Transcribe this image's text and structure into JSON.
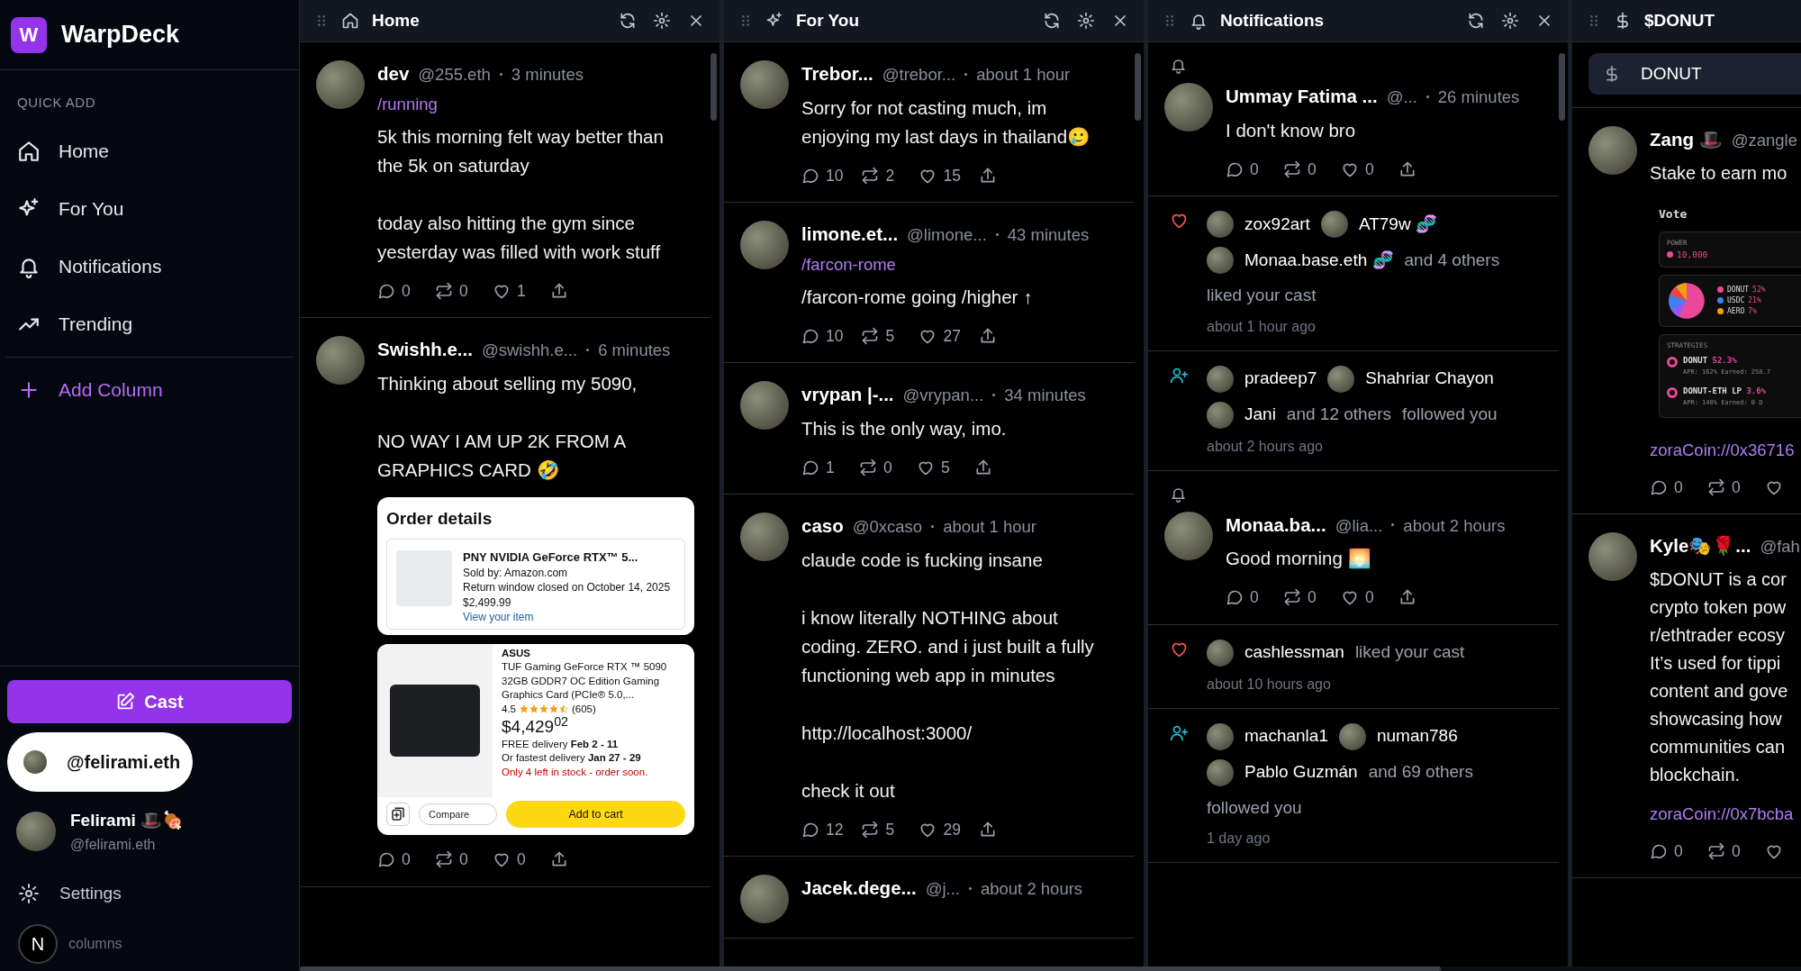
{
  "app": {
    "logo_letter": "W",
    "name": "WarpDeck"
  },
  "sidebar": {
    "section_label": "QUICK ADD",
    "items": [
      {
        "label": "Home"
      },
      {
        "label": "For You"
      },
      {
        "label": "Notifications"
      },
      {
        "label": "Trending"
      }
    ],
    "add_column": "Add Column",
    "cast_button": "Cast",
    "account_chip": "@felirami.eth",
    "profile": {
      "name": "Felirami 🎩🍖",
      "handle": "@felirami.eth"
    },
    "settings": "Settings",
    "dev_badge": "N",
    "footer": "columns"
  },
  "columns": [
    {
      "title": "Home",
      "posts": [
        {
          "author": "dev",
          "handle": "@255.eth",
          "time": "3 minutes",
          "channel": "/running",
          "text": "5k this morning felt way better than the 5k on saturday\n\ntoday also hitting the gym since yesterday was filled with work stuff",
          "actions": [
            {
              "kind": "reply",
              "count": "0"
            },
            {
              "kind": "recast",
              "count": "0"
            },
            {
              "kind": "like",
              "count": "1"
            },
            {
              "kind": "share"
            }
          ]
        },
        {
          "author": "Swishh.e...",
          "handle": "@swishh.e...",
          "time": "6 minutes",
          "text": "Thinking about selling my 5090,\n\nNO WAY I AM UP 2K FROM A GRAPHICS CARD 🤣",
          "media": [
            {
              "kind": "order_details",
              "title": "Order details",
              "item_title": "PNY NVIDIA GeForce RTX™ 5...",
              "seller": "Sold by: Amazon.com",
              "return_note": "Return window closed on October 14, 2025",
              "price": "$2,499.99",
              "link": "View your item"
            },
            {
              "kind": "product_listing",
              "brand": "ASUS",
              "title": "TUF Gaming GeForce RTX ™ 5090 32GB GDDR7 OC Edition Gaming Graphics Card (PCIe® 5.0,...",
              "rating": "4.5",
              "stars": 4.5,
              "reviews": "(605)",
              "price": "$4,429$^{02}$",
              "delivery": "FREE delivery **Feb 2 - 11**",
              "fastest": "Or fastest delivery **Jan 27 - 29**",
              "stock": "Only 4 left in stock - order soon.",
              "compare": "Compare",
              "cart": "Add to cart"
            }
          ],
          "actions": [
            {
              "kind": "reply",
              "count": "0"
            },
            {
              "kind": "recast",
              "count": "0"
            },
            {
              "kind": "like",
              "count": "0"
            },
            {
              "kind": "share"
            }
          ]
        }
      ]
    },
    {
      "title": "For You",
      "posts": [
        {
          "author": "Trebor...",
          "handle": "@trebor...",
          "time": "about 1 hour",
          "text": "Sorry for not casting much, im enjoying my last days in thailand🥲",
          "actions": [
            {
              "kind": "reply",
              "count": "10"
            },
            {
              "kind": "recast",
              "count": "2"
            },
            {
              "kind": "like",
              "count": "15"
            },
            {
              "kind": "share"
            }
          ]
        },
        {
          "author": "limone.et...",
          "handle": "@limone...",
          "time": "43 minutes",
          "channel": "/farcon-rome",
          "text": "/farcon-rome going /higher ↑",
          "actions": [
            {
              "kind": "reply",
              "count": "10"
            },
            {
              "kind": "recast",
              "count": "5"
            },
            {
              "kind": "like",
              "count": "27"
            },
            {
              "kind": "share"
            }
          ]
        },
        {
          "author": "vrypan |-...",
          "handle": "@vrypan...",
          "time": "34 minutes",
          "text": "This is the only way, imo.",
          "actions": [
            {
              "kind": "reply",
              "count": "1"
            },
            {
              "kind": "recast",
              "count": "0"
            },
            {
              "kind": "like",
              "count": "5"
            },
            {
              "kind": "share"
            }
          ]
        },
        {
          "author": "caso",
          "handle": "@0xcaso",
          "time": "about 1 hour",
          "text": "claude code is fucking insane\n\ni know literally NOTHING about coding. ZERO. and i just built a fully functioning web app in minutes\n\nhttp://localhost:3000/\n\ncheck it out",
          "actions": [
            {
              "kind": "reply",
              "count": "12"
            },
            {
              "kind": "recast",
              "count": "5"
            },
            {
              "kind": "like",
              "count": "29"
            },
            {
              "kind": "share"
            }
          ]
        },
        {
          "author": "Jacek.dege...",
          "handle": "@j...",
          "time": "about 2 hours"
        }
      ]
    },
    {
      "title": "Notifications",
      "notifications": [
        {
          "kind": "mention",
          "post": {
            "author": "Ummay Fatima ...",
            "handle": "@...",
            "time": "26 minutes",
            "text": "I don't know bro",
            "actions": [
              {
                "kind": "reply",
                "count": "0"
              },
              {
                "kind": "recast",
                "count": "0"
              },
              {
                "kind": "like",
                "count": "0"
              },
              {
                "kind": "share"
              }
            ]
          }
        },
        {
          "kind": "like",
          "users": [
            "zox92art",
            "AT79w 🧬",
            "Monaa.base.eth 🧬"
          ],
          "others": "and 4 others",
          "action": "liked your cast",
          "time": "about 1 hour ago"
        },
        {
          "kind": "follow",
          "users": [
            "pradeep7",
            "Shahriar Chayon",
            "Jani"
          ],
          "others": "and 12 others",
          "action": "followed you",
          "time": "about 2 hours ago"
        },
        {
          "kind": "mention",
          "post": {
            "author": "Monaa.ba...",
            "handle": "@lia...",
            "time": "about 2 hours",
            "text": "Good morning 🌅",
            "actions": [
              {
                "kind": "reply",
                "count": "0"
              },
              {
                "kind": "recast",
                "count": "0"
              },
              {
                "kind": "like",
                "count": "0"
              },
              {
                "kind": "share"
              }
            ]
          }
        },
        {
          "kind": "like",
          "users": [
            "cashlessman"
          ],
          "action": "liked your cast",
          "time": "about 10 hours ago"
        },
        {
          "kind": "follow",
          "users": [
            "machanla1",
            "numan786",
            "Pablo Guzmán"
          ],
          "others": "and 69 others",
          "action": "followed you",
          "time": "1 day ago"
        }
      ]
    },
    {
      "title": "$DONUT",
      "search": {
        "value": "DONUT"
      },
      "posts": [
        {
          "author": "Zang 🎩",
          "handle": "@zangle",
          "text": "Stake to earn mo",
          "media": [
            {
              "kind": "vote_panel",
              "title": "Vote",
              "power_label": "POWER",
              "power_value": "10,000",
              "legend": [
                {
                  "label": "DONUT",
                  "value": "52%",
                  "color": "#ec4899"
                },
                {
                  "label": "USDC",
                  "value": "21%",
                  "color": "#3b82f6"
                },
                {
                  "label": "AERO",
                  "value": "7%",
                  "color": "#f59e0b"
                }
              ],
              "strategies_label": "STRATEGIES",
              "strategies": [
                {
                  "name": "DONUT",
                  "share": "52.3%",
                  "detail": "APR: 162% Earned: 258.7"
                },
                {
                  "name": "DONUT-ETH LP",
                  "share": "3.6%",
                  "detail": "APR: 148% Earned: 0 D"
                }
              ]
            }
          ],
          "link": "zoraCoin://0x36716",
          "actions": [
            {
              "kind": "reply",
              "count": "0"
            },
            {
              "kind": "recast",
              "count": "0"
            },
            {
              "kind": "like"
            }
          ]
        },
        {
          "author": "Kyle🎭🌹...",
          "handle": "@fah",
          "text": "$DONUT is a cor\ncrypto token pow\nr/ethtrader ecosy\nIt’s used for tippi\ncontent and gove\nshowcasing how\ncommunities can\nblockchain.",
          "link": "zoraCoin://0x7bcba",
          "actions": [
            {
              "kind": "reply",
              "count": "0"
            },
            {
              "kind": "recast",
              "count": "0"
            },
            {
              "kind": "like"
            }
          ]
        }
      ]
    }
  ]
}
